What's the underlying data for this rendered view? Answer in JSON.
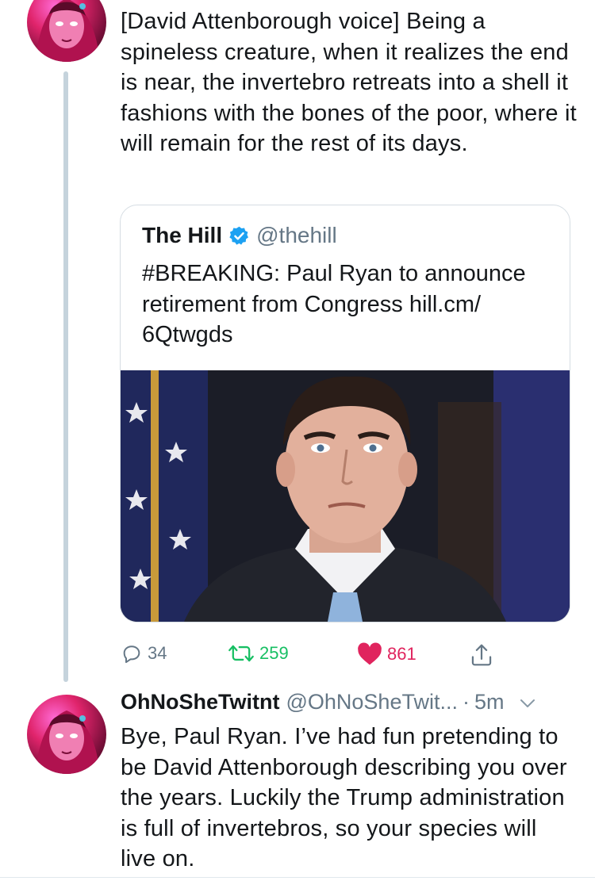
{
  "tweet1": {
    "text": "[David Attenborough voice] Being a spineless creature, when it realizes the end is near, the invertebro retreats into a shell it fashions with the bones of the poor, where it will remain for the rest of its days.",
    "quote": {
      "name": "The Hill",
      "handle": "@thehill",
      "text": "#BREAKING: Paul Ryan to announce retirement from Congress hill.cm/ 6Qtwgds"
    },
    "actions": {
      "replies": "34",
      "retweets": "259",
      "likes": "861"
    }
  },
  "tweet2": {
    "name": "OhNoSheTwitnt",
    "handle": "@OhNoSheTwit...",
    "separator": "·",
    "time": "5m",
    "text": "Bye, Paul Ryan. I’ve had fun pretending to be David Attenborough describing you over the years. Luckily the Trump administration is full of invertebros, so your species will live on."
  },
  "colors": {
    "accent": "#1da1f2",
    "retweet": "#17bf63",
    "like": "#e0245e",
    "muted": "#657786"
  },
  "icons": {
    "verified": "verified-badge-icon",
    "reply": "reply-icon",
    "retweet": "retweet-icon",
    "like": "heart-icon",
    "share": "share-icon",
    "more": "chevron-down-icon"
  }
}
